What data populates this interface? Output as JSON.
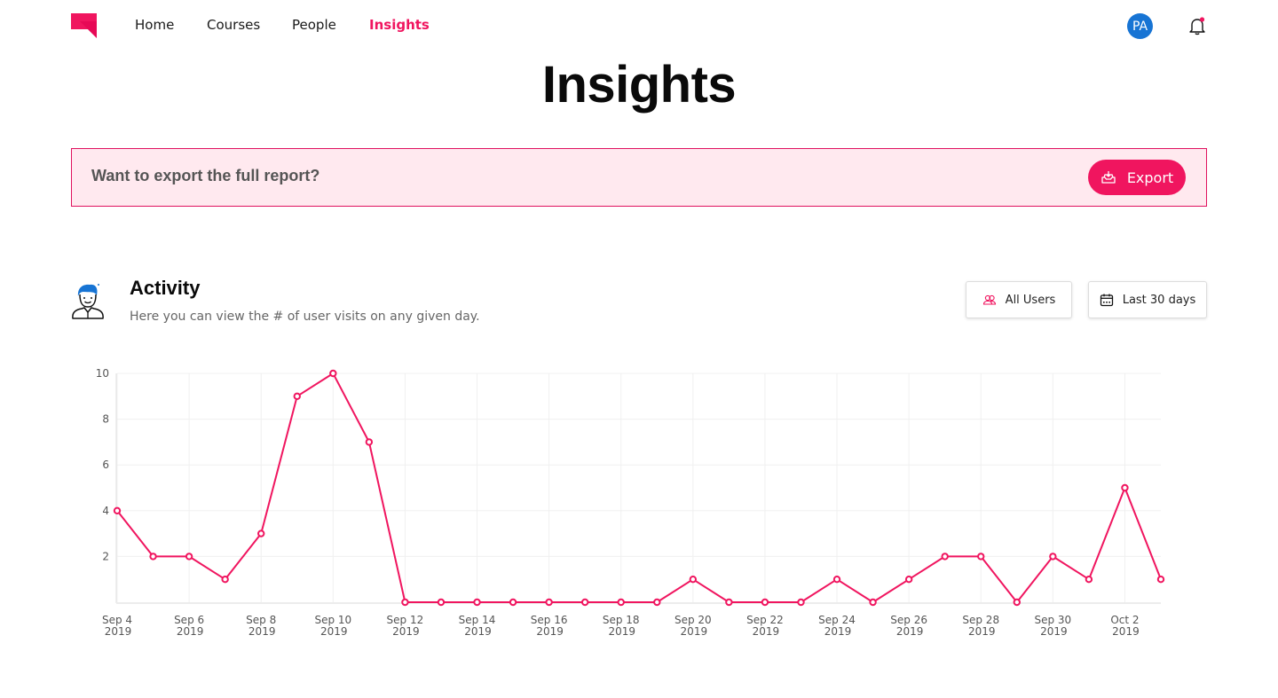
{
  "nav": {
    "logo": "brand-logo",
    "links": [
      {
        "label": "Home",
        "active": false
      },
      {
        "label": "Courses",
        "active": false
      },
      {
        "label": "People",
        "active": false
      },
      {
        "label": "Insights",
        "active": true
      }
    ],
    "avatar_initials": "PA",
    "notification_dot": true
  },
  "page": {
    "title": "Insights"
  },
  "banner": {
    "text": "Want to export the full report?",
    "button_label": "Export",
    "button_icon": "export-tray-icon"
  },
  "activity": {
    "icon": "user-avatar-icon",
    "title": "Activity",
    "subtitle": "Here you can view the # of user visits on any given day.",
    "filters": [
      {
        "label": "All Users",
        "icon": "users-icon"
      },
      {
        "label": "Last 30 days",
        "icon": "calendar-icon"
      }
    ]
  },
  "colors": {
    "accent": "#f0155f",
    "banner_bg": "#ffe9ef",
    "avatar_bg": "#1774d4",
    "grid": "#f0f0f0"
  },
  "chart_data": {
    "type": "line",
    "title": "",
    "xlabel": "",
    "ylabel": "",
    "ylim": [
      0,
      10
    ],
    "yticks": [
      2,
      4,
      6,
      8,
      10
    ],
    "grid": true,
    "legend": "none",
    "x": [
      "Sep 4 2019",
      "Sep 5 2019",
      "Sep 6 2019",
      "Sep 7 2019",
      "Sep 8 2019",
      "Sep 9 2019",
      "Sep 10 2019",
      "Sep 11 2019",
      "Sep 12 2019",
      "Sep 13 2019",
      "Sep 14 2019",
      "Sep 15 2019",
      "Sep 16 2019",
      "Sep 17 2019",
      "Sep 18 2019",
      "Sep 19 2019",
      "Sep 20 2019",
      "Sep 21 2019",
      "Sep 22 2019",
      "Sep 23 2019",
      "Sep 24 2019",
      "Sep 25 2019",
      "Sep 26 2019",
      "Sep 27 2019",
      "Sep 28 2019",
      "Sep 29 2019",
      "Sep 30 2019",
      "Oct 1 2019",
      "Oct 2 2019",
      "Oct 3 2019"
    ],
    "xtick_labels": [
      [
        "Sep 4",
        "2019"
      ],
      [
        "Sep 6",
        "2019"
      ],
      [
        "Sep 8",
        "2019"
      ],
      [
        "Sep 10",
        "2019"
      ],
      [
        "Sep 12",
        "2019"
      ],
      [
        "Sep 14",
        "2019"
      ],
      [
        "Sep 16",
        "2019"
      ],
      [
        "Sep 18",
        "2019"
      ],
      [
        "Sep 20",
        "2019"
      ],
      [
        "Sep 22",
        "2019"
      ],
      [
        "Sep 24",
        "2019"
      ],
      [
        "Sep 26",
        "2019"
      ],
      [
        "Sep 28",
        "2019"
      ],
      [
        "Sep 30",
        "2019"
      ],
      [
        "Oct 2",
        "2019"
      ]
    ],
    "series": [
      {
        "name": "User visits",
        "color": "#f0155f",
        "values": [
          4,
          2,
          2,
          1,
          3,
          9,
          10,
          7,
          0,
          0,
          0,
          0,
          0,
          0,
          0,
          0,
          1,
          0,
          0,
          0,
          1,
          0,
          1,
          2,
          2,
          0,
          2,
          1,
          5,
          1
        ]
      }
    ]
  }
}
